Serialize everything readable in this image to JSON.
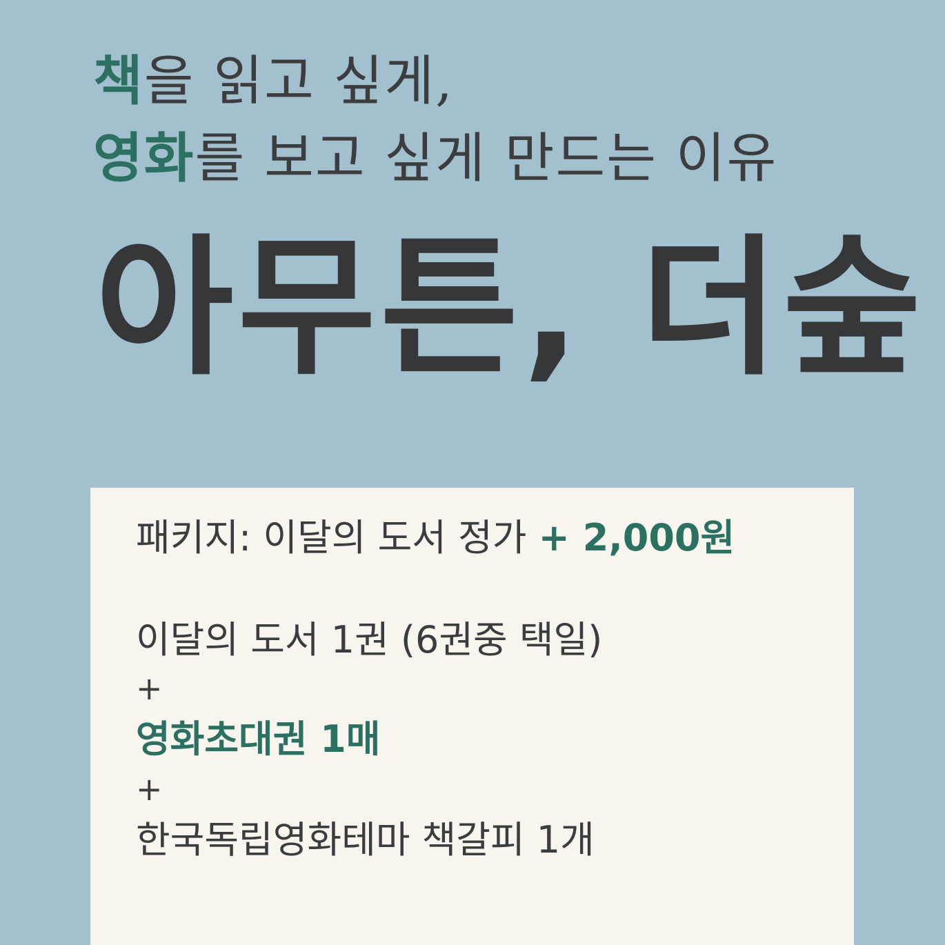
{
  "tagline": {
    "line1": {
      "highlight": "책",
      "rest": "을 읽고 싶게,"
    },
    "line2": {
      "highlight": "영화",
      "rest": "를 보고 싶게 만드는 이유"
    }
  },
  "brand": {
    "name": "아무튼, 더숲"
  },
  "card": {
    "package_label": "패키지: 이달의 도서 정가 ",
    "package_price": "+ 2,000원",
    "item1": "이달의 도서 1권 (6권중 택일)",
    "plus1": "+",
    "item2": "영화초대권 1매",
    "plus2": "+",
    "item3": "한국독립영화테마 책갈피 1개"
  },
  "colors": {
    "background": "#a3c0cf",
    "accent": "#2b7060",
    "text": "#3a3c3e",
    "card": "#f8f4ee"
  }
}
